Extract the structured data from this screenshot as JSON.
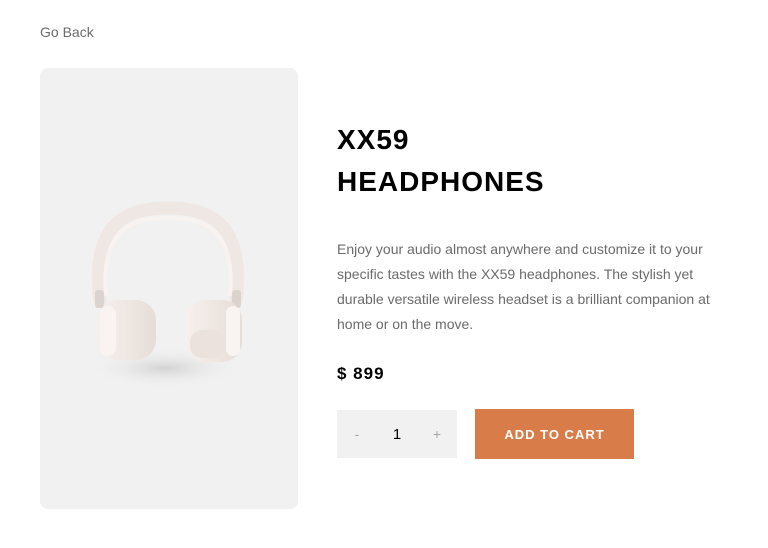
{
  "nav": {
    "go_back_label": "Go Back"
  },
  "product": {
    "image_icon": "headphones-image",
    "title_line1": "XX59",
    "title_line2": "HEADPHONES",
    "description": "Enjoy your audio almost anywhere and customize it to your specific tastes with the XX59 headphones. The stylish yet durable versatile wireless headset is a brilliant companion at home or on the move.",
    "price": "$ 899"
  },
  "cart": {
    "decrement_label": "-",
    "quantity": "1",
    "increment_label": "+",
    "add_to_cart_label": "ADD TO CART"
  },
  "colors": {
    "accent": "#d87d4a",
    "card_background": "#f1f1f1",
    "text_muted": "#6b6b6b"
  }
}
